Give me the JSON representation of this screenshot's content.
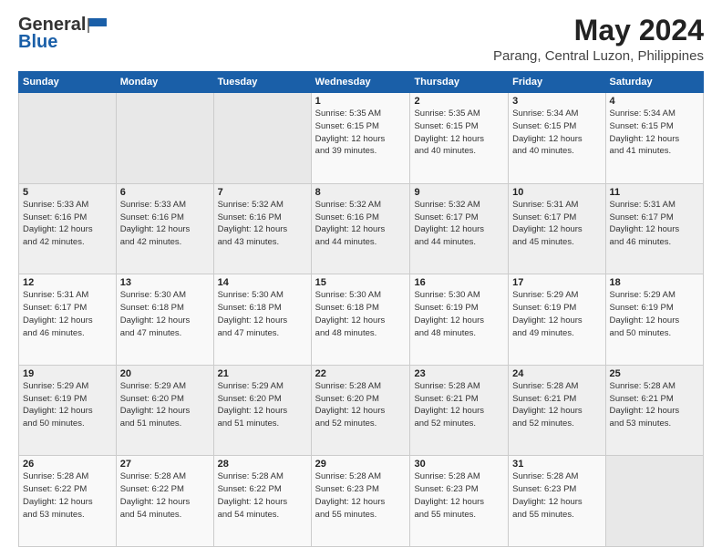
{
  "header": {
    "logo_general": "General",
    "logo_blue": "Blue",
    "title": "May 2024",
    "subtitle": "Parang, Central Luzon, Philippines"
  },
  "calendar": {
    "days_of_week": [
      "Sunday",
      "Monday",
      "Tuesday",
      "Wednesday",
      "Thursday",
      "Friday",
      "Saturday"
    ],
    "weeks": [
      [
        {
          "day": "",
          "info": ""
        },
        {
          "day": "",
          "info": ""
        },
        {
          "day": "",
          "info": ""
        },
        {
          "day": "1",
          "info": "Sunrise: 5:35 AM\nSunset: 6:15 PM\nDaylight: 12 hours\nand 39 minutes."
        },
        {
          "day": "2",
          "info": "Sunrise: 5:35 AM\nSunset: 6:15 PM\nDaylight: 12 hours\nand 40 minutes."
        },
        {
          "day": "3",
          "info": "Sunrise: 5:34 AM\nSunset: 6:15 PM\nDaylight: 12 hours\nand 40 minutes."
        },
        {
          "day": "4",
          "info": "Sunrise: 5:34 AM\nSunset: 6:15 PM\nDaylight: 12 hours\nand 41 minutes."
        }
      ],
      [
        {
          "day": "5",
          "info": "Sunrise: 5:33 AM\nSunset: 6:16 PM\nDaylight: 12 hours\nand 42 minutes."
        },
        {
          "day": "6",
          "info": "Sunrise: 5:33 AM\nSunset: 6:16 PM\nDaylight: 12 hours\nand 42 minutes."
        },
        {
          "day": "7",
          "info": "Sunrise: 5:32 AM\nSunset: 6:16 PM\nDaylight: 12 hours\nand 43 minutes."
        },
        {
          "day": "8",
          "info": "Sunrise: 5:32 AM\nSunset: 6:16 PM\nDaylight: 12 hours\nand 44 minutes."
        },
        {
          "day": "9",
          "info": "Sunrise: 5:32 AM\nSunset: 6:17 PM\nDaylight: 12 hours\nand 44 minutes."
        },
        {
          "day": "10",
          "info": "Sunrise: 5:31 AM\nSunset: 6:17 PM\nDaylight: 12 hours\nand 45 minutes."
        },
        {
          "day": "11",
          "info": "Sunrise: 5:31 AM\nSunset: 6:17 PM\nDaylight: 12 hours\nand 46 minutes."
        }
      ],
      [
        {
          "day": "12",
          "info": "Sunrise: 5:31 AM\nSunset: 6:17 PM\nDaylight: 12 hours\nand 46 minutes."
        },
        {
          "day": "13",
          "info": "Sunrise: 5:30 AM\nSunset: 6:18 PM\nDaylight: 12 hours\nand 47 minutes."
        },
        {
          "day": "14",
          "info": "Sunrise: 5:30 AM\nSunset: 6:18 PM\nDaylight: 12 hours\nand 47 minutes."
        },
        {
          "day": "15",
          "info": "Sunrise: 5:30 AM\nSunset: 6:18 PM\nDaylight: 12 hours\nand 48 minutes."
        },
        {
          "day": "16",
          "info": "Sunrise: 5:30 AM\nSunset: 6:19 PM\nDaylight: 12 hours\nand 48 minutes."
        },
        {
          "day": "17",
          "info": "Sunrise: 5:29 AM\nSunset: 6:19 PM\nDaylight: 12 hours\nand 49 minutes."
        },
        {
          "day": "18",
          "info": "Sunrise: 5:29 AM\nSunset: 6:19 PM\nDaylight: 12 hours\nand 50 minutes."
        }
      ],
      [
        {
          "day": "19",
          "info": "Sunrise: 5:29 AM\nSunset: 6:19 PM\nDaylight: 12 hours\nand 50 minutes."
        },
        {
          "day": "20",
          "info": "Sunrise: 5:29 AM\nSunset: 6:20 PM\nDaylight: 12 hours\nand 51 minutes."
        },
        {
          "day": "21",
          "info": "Sunrise: 5:29 AM\nSunset: 6:20 PM\nDaylight: 12 hours\nand 51 minutes."
        },
        {
          "day": "22",
          "info": "Sunrise: 5:28 AM\nSunset: 6:20 PM\nDaylight: 12 hours\nand 52 minutes."
        },
        {
          "day": "23",
          "info": "Sunrise: 5:28 AM\nSunset: 6:21 PM\nDaylight: 12 hours\nand 52 minutes."
        },
        {
          "day": "24",
          "info": "Sunrise: 5:28 AM\nSunset: 6:21 PM\nDaylight: 12 hours\nand 52 minutes."
        },
        {
          "day": "25",
          "info": "Sunrise: 5:28 AM\nSunset: 6:21 PM\nDaylight: 12 hours\nand 53 minutes."
        }
      ],
      [
        {
          "day": "26",
          "info": "Sunrise: 5:28 AM\nSunset: 6:22 PM\nDaylight: 12 hours\nand 53 minutes."
        },
        {
          "day": "27",
          "info": "Sunrise: 5:28 AM\nSunset: 6:22 PM\nDaylight: 12 hours\nand 54 minutes."
        },
        {
          "day": "28",
          "info": "Sunrise: 5:28 AM\nSunset: 6:22 PM\nDaylight: 12 hours\nand 54 minutes."
        },
        {
          "day": "29",
          "info": "Sunrise: 5:28 AM\nSunset: 6:23 PM\nDaylight: 12 hours\nand 55 minutes."
        },
        {
          "day": "30",
          "info": "Sunrise: 5:28 AM\nSunset: 6:23 PM\nDaylight: 12 hours\nand 55 minutes."
        },
        {
          "day": "31",
          "info": "Sunrise: 5:28 AM\nSunset: 6:23 PM\nDaylight: 12 hours\nand 55 minutes."
        },
        {
          "day": "",
          "info": ""
        }
      ]
    ]
  }
}
